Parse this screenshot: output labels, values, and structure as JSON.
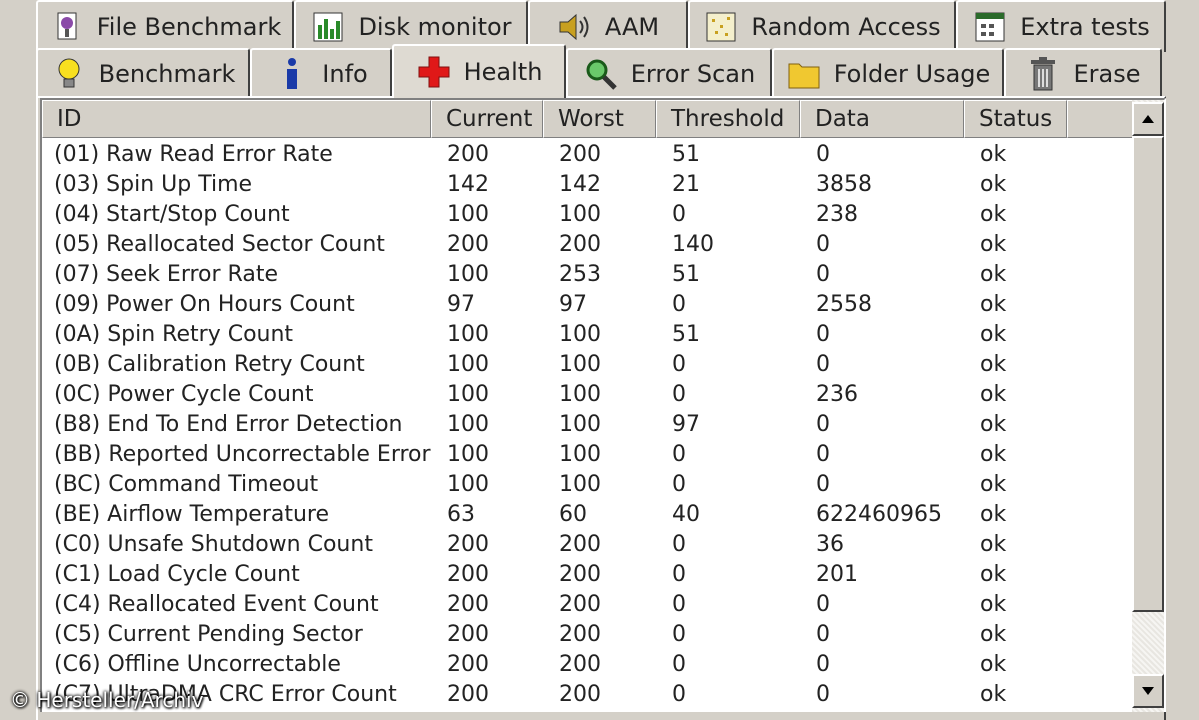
{
  "tabs_top": [
    {
      "label": "File Benchmark",
      "icon": "file-benchmark-icon"
    },
    {
      "label": "Disk monitor",
      "icon": "disk-monitor-icon"
    },
    {
      "label": "AAM",
      "icon": "speaker-icon"
    },
    {
      "label": "Random Access",
      "icon": "random-access-icon"
    },
    {
      "label": "Extra tests",
      "icon": "extra-tests-icon"
    }
  ],
  "tabs_bottom": [
    {
      "label": "Benchmark",
      "icon": "lightbulb-icon"
    },
    {
      "label": "Info",
      "icon": "info-icon"
    },
    {
      "label": "Health",
      "icon": "health-cross-icon",
      "active": true
    },
    {
      "label": "Error Scan",
      "icon": "magnifier-icon"
    },
    {
      "label": "Folder Usage",
      "icon": "folder-icon"
    },
    {
      "label": "Erase",
      "icon": "trash-icon"
    }
  ],
  "columns": [
    "ID",
    "Current",
    "Worst",
    "Threshold",
    "Data",
    "Status"
  ],
  "rows": [
    [
      "(01) Raw Read Error Rate",
      "200",
      "200",
      "51",
      "0",
      "ok"
    ],
    [
      "(03) Spin Up Time",
      "142",
      "142",
      "21",
      "3858",
      "ok"
    ],
    [
      "(04) Start/Stop Count",
      "100",
      "100",
      "0",
      "238",
      "ok"
    ],
    [
      "(05) Reallocated Sector Count",
      "200",
      "200",
      "140",
      "0",
      "ok"
    ],
    [
      "(07) Seek Error Rate",
      "100",
      "253",
      "51",
      "0",
      "ok"
    ],
    [
      "(09) Power On Hours Count",
      "97",
      "97",
      "0",
      "2558",
      "ok"
    ],
    [
      "(0A) Spin Retry Count",
      "100",
      "100",
      "51",
      "0",
      "ok"
    ],
    [
      "(0B) Calibration Retry Count",
      "100",
      "100",
      "0",
      "0",
      "ok"
    ],
    [
      "(0C) Power Cycle Count",
      "100",
      "100",
      "0",
      "236",
      "ok"
    ],
    [
      "(B8) End To End Error Detection",
      "100",
      "100",
      "97",
      "0",
      "ok"
    ],
    [
      "(BB) Reported Uncorrectable Errors",
      "100",
      "100",
      "0",
      "0",
      "ok"
    ],
    [
      "(BC) Command Timeout",
      "100",
      "100",
      "0",
      "0",
      "ok"
    ],
    [
      "(BE) Airflow Temperature",
      "63",
      "60",
      "40",
      "622460965",
      "ok"
    ],
    [
      "(C0) Unsafe Shutdown Count",
      "200",
      "200",
      "0",
      "36",
      "ok"
    ],
    [
      "(C1) Load Cycle Count",
      "200",
      "200",
      "0",
      "201",
      "ok"
    ],
    [
      "(C4) Reallocated Event Count",
      "200",
      "200",
      "0",
      "0",
      "ok"
    ],
    [
      "(C5) Current Pending Sector",
      "200",
      "200",
      "0",
      "0",
      "ok"
    ],
    [
      "(C6) Offline Uncorrectable",
      "200",
      "200",
      "0",
      "0",
      "ok"
    ],
    [
      "(C7) UltraDMA CRC Error Count",
      "200",
      "200",
      "0",
      "0",
      "ok"
    ]
  ],
  "credit": "© Hersteller/Archiv",
  "colors": {
    "window_bg": "#d4d0c8",
    "list_bg": "#ffffff",
    "health_red": "#e01818"
  }
}
